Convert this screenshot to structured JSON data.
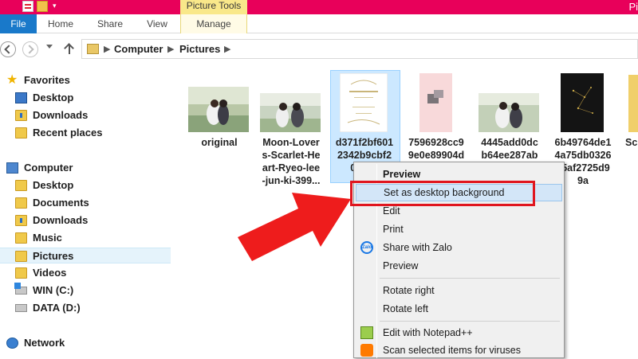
{
  "window": {
    "contextual_tab_group": "Picture Tools",
    "title_fragment": "Pi"
  },
  "ribbon": {
    "tabs": [
      "File",
      "Home",
      "Share",
      "View",
      "Manage"
    ]
  },
  "address": {
    "crumbs": [
      "Computer",
      "Pictures"
    ]
  },
  "navigation": {
    "favorites_header": "Favorites",
    "favorites": [
      "Desktop",
      "Downloads",
      "Recent places"
    ],
    "computer_header": "Computer",
    "computer": [
      "Desktop",
      "Documents",
      "Downloads",
      "Music",
      "Pictures",
      "Videos",
      "WIN (C:)",
      "DATA (D:)"
    ],
    "selected": "Pictures",
    "network_header": "Network"
  },
  "files": [
    {
      "name_lines": [
        "original"
      ]
    },
    {
      "name_lines": [
        "Moon-Lover",
        "s-Scarlet-He",
        "art-Ryeo-lee",
        "-jun-ki-399..."
      ]
    },
    {
      "name_lines": [
        "d371f2bf601",
        "2342b9cbf2",
        "0cfc..."
      ],
      "selected": true
    },
    {
      "name_lines": [
        "7596928cc9",
        "9e0e89904d"
      ]
    },
    {
      "name_lines": [
        "4445add0dc",
        "b64ee287ab"
      ]
    },
    {
      "name_lines": [
        "6b49764de1",
        "4a75db0326",
        "25af2725d9",
        "9a"
      ]
    },
    {
      "name_lines": [
        "Sc"
      ]
    }
  ],
  "context_menu": {
    "items": [
      {
        "label": "Preview",
        "bold": true
      },
      {
        "label": "Set as desktop background",
        "highlighted": true
      },
      {
        "label": "Edit"
      },
      {
        "label": "Print"
      },
      {
        "label": "Share with Zalo",
        "icon": "zalo-icon"
      },
      {
        "label": "Preview"
      },
      {
        "label": "Rotate right"
      },
      {
        "label": "Rotate left"
      },
      {
        "label": "Edit with Notepad++",
        "icon": "notepad-plus-plus-icon"
      },
      {
        "label": "Scan selected items for viruses",
        "icon": "avast-icon"
      }
    ],
    "zalo_icon_text": "Zalo"
  },
  "colors": {
    "titlebar": "#e8005a",
    "file_tab": "#1979ca",
    "annotation": "#e0161f",
    "selection": "#cce8ff"
  }
}
